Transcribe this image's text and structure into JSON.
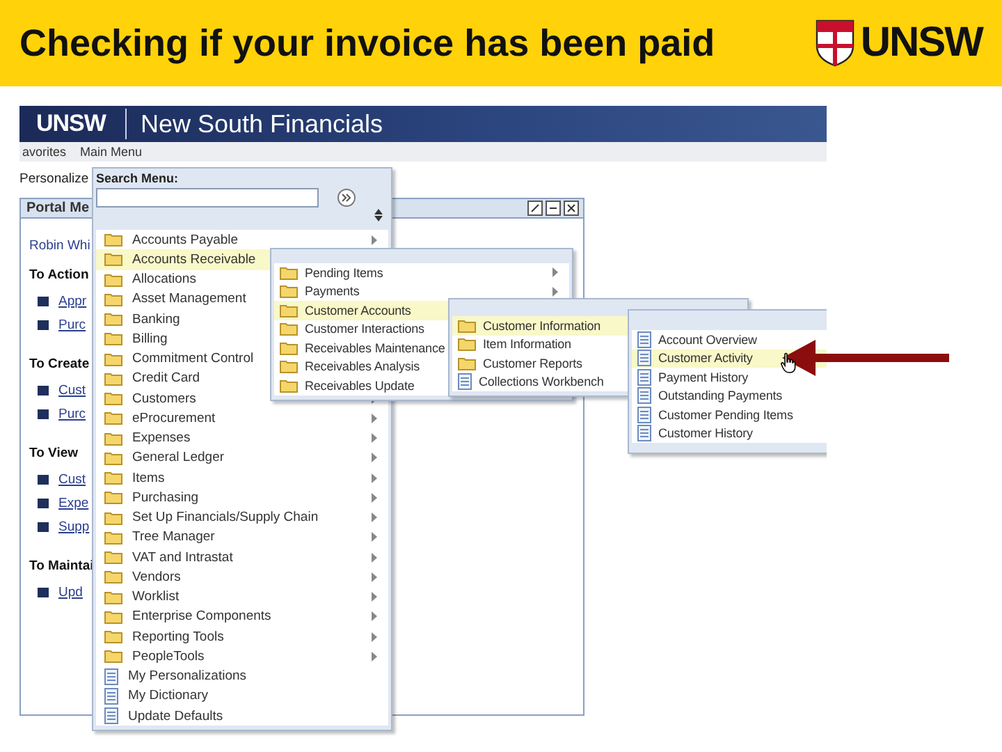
{
  "slide_title": "Checking if your invoice has been paid",
  "logo": {
    "text": "UNSW"
  },
  "app": {
    "brand": "UNSW",
    "product": "New South Financials",
    "nav": [
      {
        "label": "avorites"
      },
      {
        "label": "Main Menu"
      }
    ],
    "personalize": "Personalize",
    "portal": {
      "title": "Portal Me",
      "user": "Robin Whi",
      "sections": [
        {
          "heading": "To Action",
          "links": [
            "Appr",
            "Purc"
          ]
        },
        {
          "heading": "To Create",
          "links": [
            "Cust",
            "Purc"
          ]
        },
        {
          "heading": "To View",
          "links": [
            "Cust",
            "Expe",
            "Supp"
          ]
        },
        {
          "heading": "To Maintai",
          "links": [
            "Upd"
          ]
        }
      ]
    },
    "main_menu": {
      "search_label": "Search Menu:",
      "items": [
        {
          "label": "Accounts Payable",
          "kind": "folder",
          "selected": false
        },
        {
          "label": "Accounts Receivable",
          "kind": "folder",
          "selected": true
        },
        {
          "label": "Allocations",
          "kind": "folder",
          "selected": false
        },
        {
          "label": "Asset Management",
          "kind": "folder",
          "selected": false
        },
        {
          "label": "Banking",
          "kind": "folder",
          "selected": false
        },
        {
          "label": "Billing",
          "kind": "folder",
          "selected": false
        },
        {
          "label": "Commitment Control",
          "kind": "folder",
          "selected": false
        },
        {
          "label": "Credit Card",
          "kind": "folder",
          "selected": false
        },
        {
          "label": "Customers",
          "kind": "folder",
          "selected": false
        },
        {
          "label": "eProcurement",
          "kind": "folder",
          "selected": false
        },
        {
          "label": "Expenses",
          "kind": "folder",
          "selected": false
        },
        {
          "label": "General Ledger",
          "kind": "folder",
          "selected": false
        },
        {
          "label": "Items",
          "kind": "folder",
          "selected": false
        },
        {
          "label": "Purchasing",
          "kind": "folder",
          "selected": false
        },
        {
          "label": "Set Up Financials/Supply Chain",
          "kind": "folder",
          "selected": false
        },
        {
          "label": "Tree Manager",
          "kind": "folder",
          "selected": false
        },
        {
          "label": "VAT and Intrastat",
          "kind": "folder",
          "selected": false
        },
        {
          "label": "Vendors",
          "kind": "folder",
          "selected": false
        },
        {
          "label": "Worklist",
          "kind": "folder",
          "selected": false
        },
        {
          "label": "Enterprise Components",
          "kind": "folder",
          "selected": false
        },
        {
          "label": "Reporting Tools",
          "kind": "folder",
          "selected": false
        },
        {
          "label": "PeopleTools",
          "kind": "folder",
          "selected": false
        },
        {
          "label": "My Personalizations",
          "kind": "page",
          "selected": false
        },
        {
          "label": "My Dictionary",
          "kind": "page",
          "selected": false
        },
        {
          "label": "Update Defaults",
          "kind": "page",
          "selected": false
        }
      ]
    },
    "submenus": [
      {
        "items": [
          {
            "label": "Pending Items",
            "kind": "folder",
            "selected": false
          },
          {
            "label": "Payments",
            "kind": "folder",
            "selected": false
          },
          {
            "label": "Customer Accounts",
            "kind": "folder",
            "selected": true
          },
          {
            "label": "Customer Interactions",
            "kind": "folder",
            "selected": false
          },
          {
            "label": "Receivables Maintenance",
            "kind": "folder",
            "selected": false
          },
          {
            "label": "Receivables Analysis",
            "kind": "folder",
            "selected": false
          },
          {
            "label": "Receivables Update",
            "kind": "folder",
            "selected": false
          }
        ]
      },
      {
        "items": [
          {
            "label": "Customer Information",
            "kind": "folder",
            "selected": true
          },
          {
            "label": "Item Information",
            "kind": "folder",
            "selected": false
          },
          {
            "label": "Customer Reports",
            "kind": "folder",
            "selected": false
          },
          {
            "label": "Collections Workbench",
            "kind": "page",
            "selected": false
          }
        ]
      },
      {
        "items": [
          {
            "label": "Account Overview",
            "kind": "page",
            "selected": false
          },
          {
            "label": "Customer Activity",
            "kind": "page",
            "selected": true
          },
          {
            "label": "Payment History",
            "kind": "page",
            "selected": false
          },
          {
            "label": "Outstanding Payments",
            "kind": "page",
            "selected": false
          },
          {
            "label": "Customer Pending Items",
            "kind": "page",
            "selected": false
          },
          {
            "label": "Customer History",
            "kind": "page",
            "selected": false
          }
        ]
      }
    ]
  }
}
